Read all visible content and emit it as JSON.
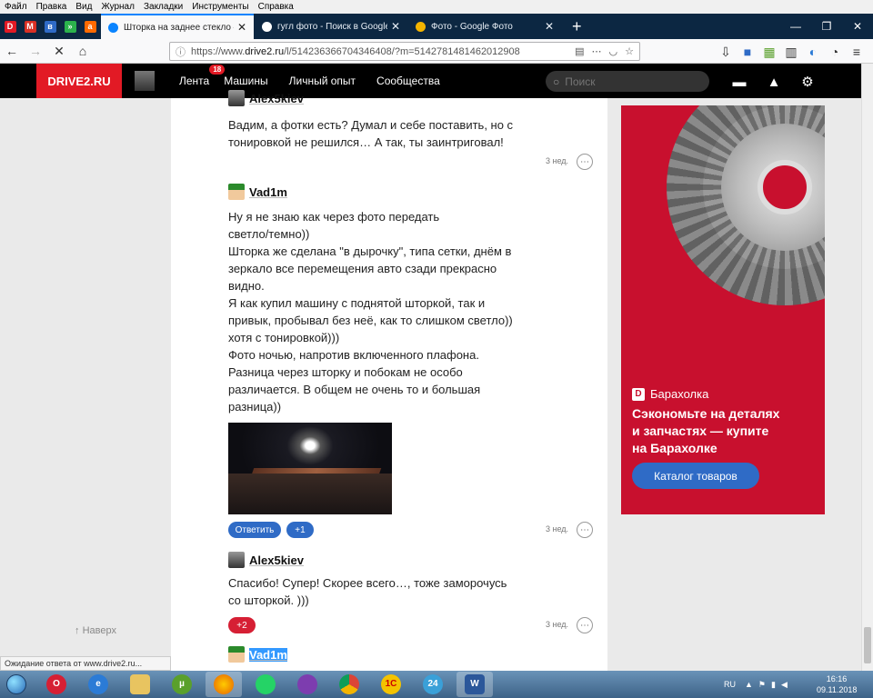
{
  "menubar": [
    "Файл",
    "Правка",
    "Вид",
    "Журнал",
    "Закладки",
    "Инструменты",
    "Справка"
  ],
  "tabs": [
    {
      "title": "Шторка на заднее стекло — б",
      "active": true,
      "fav_color": "#0a84ff"
    },
    {
      "title": "гугл фото - Поиск в Google",
      "active": false,
      "fav_color": "#ffffff"
    },
    {
      "title": "Фото - Google Фото",
      "active": false,
      "fav_color": "#f4b400"
    }
  ],
  "pinned_tabs": [
    {
      "icon": "drive2-icon",
      "label": "D",
      "color": "#e21a25"
    },
    {
      "icon": "gmail-icon",
      "label": "M",
      "color": "#d93025"
    },
    {
      "icon": "vk-icon",
      "label": "в",
      "color": "#2f6bc6"
    },
    {
      "icon": "feedly-icon",
      "label": "»",
      "color": "#2bb24c"
    },
    {
      "icon": "aliexpress-icon",
      "label": "a",
      "color": "#ff6a00"
    }
  ],
  "url": {
    "prefix": "https://www.",
    "domain": "drive2.ru",
    "path": "/l/514236366704346408/?m=5142781481462012908"
  },
  "site": {
    "logo": "DRIVE2.RU",
    "nav": [
      {
        "label": "Лента",
        "badge": "18"
      },
      {
        "label": "Машины"
      },
      {
        "label": "Личный опыт"
      },
      {
        "label": "Сообщества"
      }
    ],
    "search_placeholder": "Поиск"
  },
  "comments": [
    {
      "author": "Alex5kiev",
      "text": "Вадим, а фотки есть? Думал и себе поставить, но с\nтонировкой не решился… А так, ты заинтриговал!",
      "time": "3 нед."
    },
    {
      "author": "Vad1m",
      "text": "Ну я не знаю как через фото передать\nсветло/темно))\nШторка же сделана \"в дырочку\", типа сетки, днём в\nзеркало все перемещения авто сзади прекрасно\nвидно.\nЯ как купил машину с поднятой шторкой, так и\nпривык, пробывал без неё, как то слишком светло))\nхотя с тонировкой)))\nФото ночью, напротив включенного плафона.\nРазница через шторку и побокам не особо\nразличается. В общем не очень то и большая\nразница))",
      "time": "3 нед.",
      "reply": "Ответить",
      "likes": "+1"
    },
    {
      "author": "Alex5kiev",
      "text": "Спасибо! Супер! Скорее всего…, тоже заморочусь\nсо шторкой. )))",
      "time": "3 нед.",
      "likes": "+2"
    },
    {
      "author": "Vad1m"
    }
  ],
  "more_glyph": "⋯",
  "scroll_up": "Наверх",
  "ad": {
    "brand": "Барахолка",
    "brand_letter": "D",
    "headline": "Сэкономьте на деталях\nи запчастях — купите\nна Барахолке",
    "cta": "Каталог товаров"
  },
  "status": "Ожидание ответа от www.drive2.ru...",
  "taskbar": {
    "apps": [
      {
        "icon": "opera-icon",
        "label": "O",
        "color": "#d61f34"
      },
      {
        "icon": "ie-icon",
        "label": "e",
        "color": "#2b7bd6"
      },
      {
        "icon": "explorer-icon",
        "label": "",
        "color": "#e8c460"
      },
      {
        "icon": "utorrent-icon",
        "label": "µ",
        "color": "#5aa02c"
      },
      {
        "icon": "firefox-icon",
        "label": "",
        "color": "#e66000",
        "active": true
      },
      {
        "icon": "whatsapp-icon",
        "label": "",
        "color": "#25d366"
      },
      {
        "icon": "viber-icon",
        "label": "",
        "color": "#7d3daf"
      },
      {
        "icon": "chrome-icon",
        "label": "",
        "color": "#db4437"
      },
      {
        "icon": "1c-icon",
        "label": "1С",
        "color": "#f4c300"
      },
      {
        "icon": "24-icon",
        "label": "24",
        "color": "#3aa0d8"
      },
      {
        "icon": "word-icon",
        "label": "W",
        "color": "#2b579a",
        "active": true
      }
    ],
    "lang": "RU",
    "time": "16:16",
    "date": "09.11.2018"
  }
}
